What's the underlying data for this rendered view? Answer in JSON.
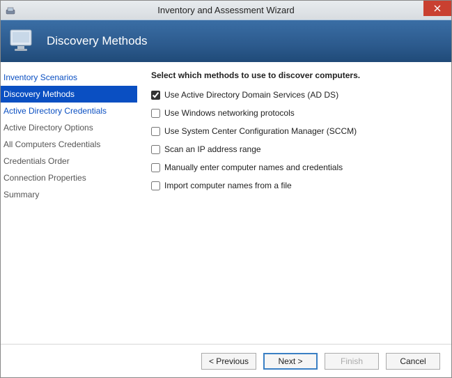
{
  "titlebar": {
    "title": "Inventory and Assessment Wizard"
  },
  "header": {
    "title": "Discovery Methods"
  },
  "sidebar": {
    "items": [
      {
        "label": "Inventory Scenarios",
        "state": "visited"
      },
      {
        "label": "Discovery Methods",
        "state": "selected"
      },
      {
        "label": "Active Directory Credentials",
        "state": "visited"
      },
      {
        "label": "Active Directory Options",
        "state": "future"
      },
      {
        "label": "All Computers Credentials",
        "state": "future"
      },
      {
        "label": "Credentials Order",
        "state": "future"
      },
      {
        "label": "Connection Properties",
        "state": "future"
      },
      {
        "label": "Summary",
        "state": "future"
      }
    ]
  },
  "main": {
    "heading": "Select which methods to use to discover computers.",
    "options": [
      {
        "label": "Use Active Directory Domain Services (AD DS)",
        "checked": true
      },
      {
        "label": "Use Windows networking protocols",
        "checked": false
      },
      {
        "label": "Use System Center Configuration Manager (SCCM)",
        "checked": false
      },
      {
        "label": "Scan an IP address range",
        "checked": false
      },
      {
        "label": "Manually enter computer names and credentials",
        "checked": false
      },
      {
        "label": "Import computer names from a file",
        "checked": false
      }
    ]
  },
  "footer": {
    "previous_label": "< Previous",
    "next_label": "Next >",
    "finish_label": "Finish",
    "cancel_label": "Cancel",
    "finish_enabled": false
  }
}
